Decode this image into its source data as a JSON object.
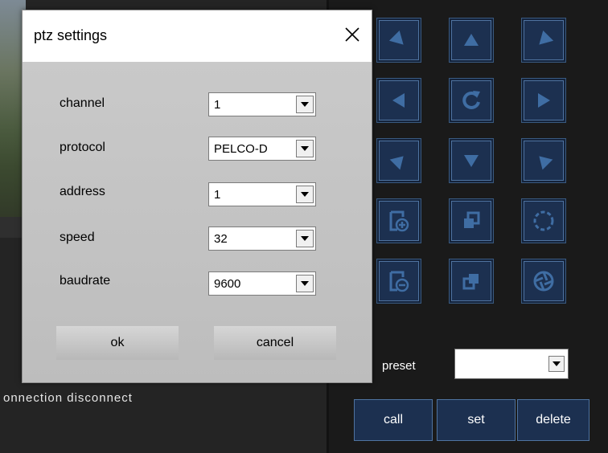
{
  "dialog": {
    "title": "ptz settings",
    "fields": [
      {
        "label": "channel",
        "value": "1"
      },
      {
        "label": "protocol",
        "value": "PELCO-D"
      },
      {
        "label": "address",
        "value": "1"
      },
      {
        "label": "speed",
        "value": "32"
      },
      {
        "label": "baudrate",
        "value": "9600"
      }
    ],
    "ok_label": "ok",
    "cancel_label": "cancel"
  },
  "status": {
    "text": "onnection disconnect"
  },
  "ptz_panel": {
    "buttons": [
      {
        "icon": "arrow-down-right-icon"
      },
      {
        "icon": "arrow-up-icon"
      },
      {
        "icon": "arrow-down-left-icon"
      },
      {
        "icon": "arrow-left-icon"
      },
      {
        "icon": "rotate-icon"
      },
      {
        "icon": "arrow-right-icon"
      },
      {
        "icon": "arrow-up-right-icon"
      },
      {
        "icon": "arrow-down-icon"
      },
      {
        "icon": "arrow-up-left-icon"
      },
      {
        "icon": "zoom-in-icon"
      },
      {
        "icon": "focus-near-icon"
      },
      {
        "icon": "iris-open-icon"
      },
      {
        "icon": "zoom-out-icon"
      },
      {
        "icon": "focus-far-icon"
      },
      {
        "icon": "iris-close-icon"
      }
    ],
    "preset_label": "preset",
    "preset_value": "",
    "call_label": "call",
    "set_label": "set",
    "delete_label": "delete"
  },
  "colors": {
    "button_bg": "#1c3050",
    "button_border": "#4f73a0",
    "dialog_bg": "#c4c4c4"
  }
}
